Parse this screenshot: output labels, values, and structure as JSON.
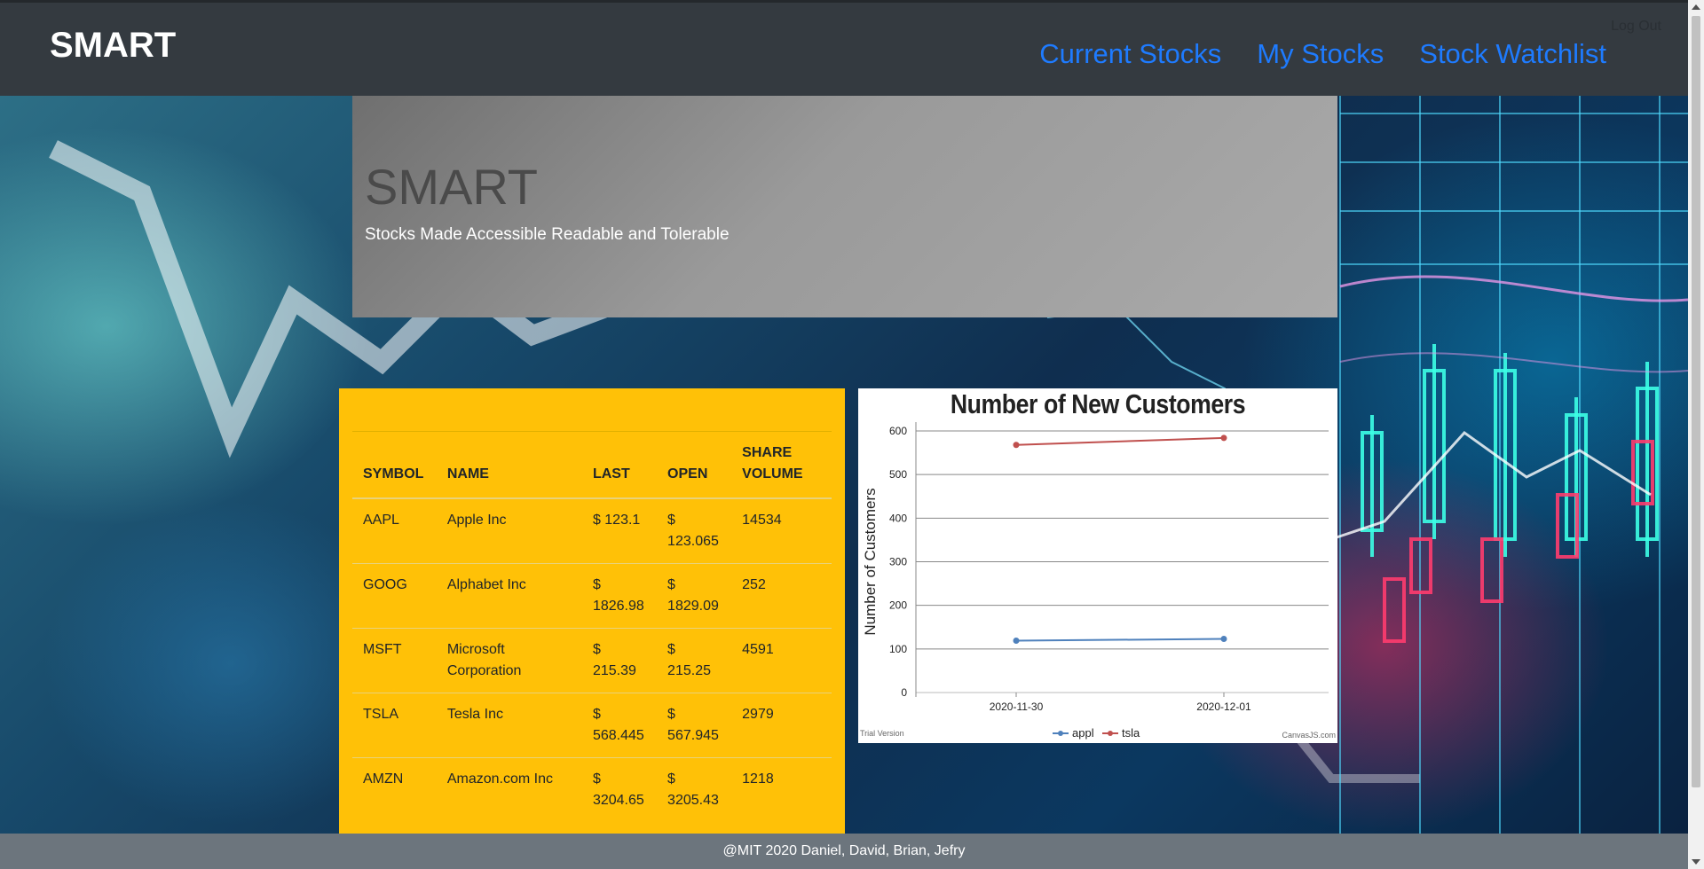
{
  "navbar": {
    "brand": "SMART",
    "links": [
      "Current Stocks",
      "My Stocks",
      "Stock Watchlist"
    ],
    "logout": "Log Out"
  },
  "jumbotron": {
    "title": "SMART",
    "subtitle": "Stocks Made Accessible Readable and Tolerable"
  },
  "stocks_table": {
    "headers": [
      "SYMBOL",
      "NAME",
      "LAST",
      "OPEN",
      "SHARE VOLUME"
    ],
    "rows": [
      [
        "AAPL",
        "Apple Inc",
        "$ 123.1",
        "$ 123.065",
        "14534"
      ],
      [
        "GOOG",
        "Alphabet Inc",
        "$ 1826.98",
        "$ 1829.09",
        "252"
      ],
      [
        "MSFT",
        "Microsoft Corporation",
        "$ 215.39",
        "$ 215.25",
        "4591"
      ],
      [
        "TSLA",
        "Tesla Inc",
        "$ 568.445",
        "$ 567.945",
        "2979"
      ],
      [
        "AMZN",
        "Amazon.com Inc",
        "$ 3204.65",
        "$ 3205.43",
        "1218"
      ]
    ]
  },
  "chart_data": {
    "type": "line",
    "title": "Number of New Customers",
    "xlabel": "",
    "ylabel": "Number of Customers",
    "x": [
      "2020-11-30",
      "2020-12-01"
    ],
    "ylim": [
      0,
      600
    ],
    "yticks": [
      0,
      100,
      200,
      300,
      400,
      500,
      600
    ],
    "grid": true,
    "legend": "bottom",
    "series": [
      {
        "name": "appl",
        "values": [
          119,
          123
        ],
        "color": "#4f81bc"
      },
      {
        "name": "tsla",
        "values": [
          568,
          584
        ],
        "color": "#c0504e"
      }
    ],
    "watermark_left": "Trial Version",
    "watermark_right": "CanvasJS.com"
  },
  "footer": {
    "text": "@MIT 2020 Daniel, David, Brian, Jefry"
  }
}
